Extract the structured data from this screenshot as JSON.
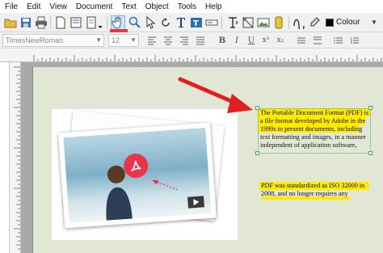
{
  "menu": [
    "File",
    "Edit",
    "View",
    "Document",
    "Text",
    "Object",
    "Tools",
    "Help"
  ],
  "toolbar": {
    "colour_label": "Colour",
    "colour_value": "#000000"
  },
  "format": {
    "font_name": "TimesNewRoman",
    "font_size": "12"
  },
  "document": {
    "paragraph1": [
      "The Portable Document Format (PDF) is",
      "a file format developed by Adobe in the",
      "1990s to present documents, including",
      "text formatting and images, in a manner",
      "independent of application software,"
    ],
    "paragraph2": [
      "PDF was standardized as ISO 32000 in",
      "2008, and no longer requires any"
    ]
  },
  "colors": {
    "highlight": "#ffeb00",
    "arrow": "#e02020",
    "page": "#e2e6d4",
    "pdf_badge": "#e9344a"
  }
}
